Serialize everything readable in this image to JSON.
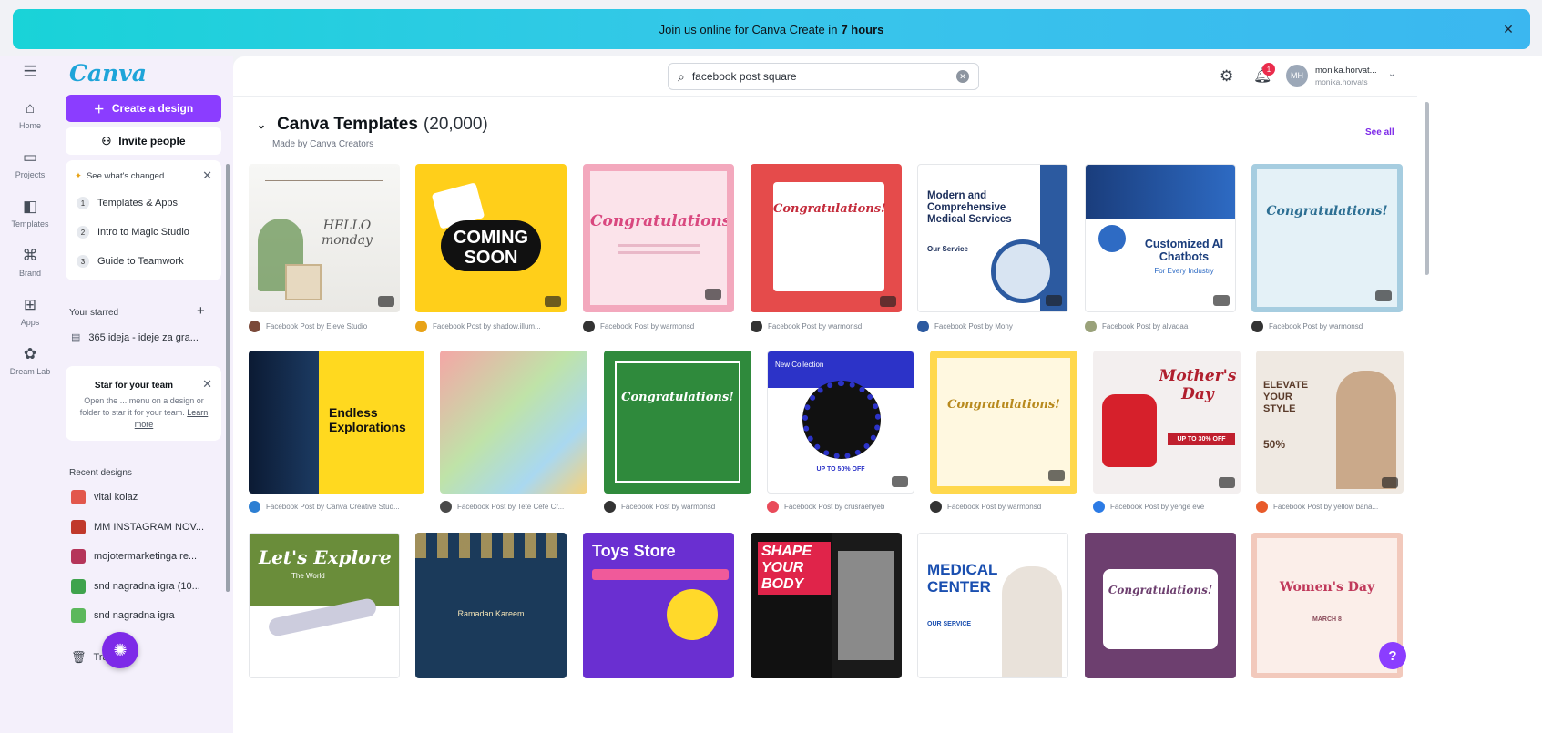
{
  "banner": {
    "text": "Join us online for Canva Create in",
    "bold": "7 hours"
  },
  "rail": [
    {
      "label": "Home",
      "icon": "home-icon"
    },
    {
      "label": "Projects",
      "icon": "folder-icon"
    },
    {
      "label": "Templates",
      "icon": "templates-icon"
    },
    {
      "label": "Brand",
      "icon": "brand-icon"
    },
    {
      "label": "Apps",
      "icon": "apps-icon"
    },
    {
      "label": "Dream Lab",
      "icon": "dream-lab-icon"
    }
  ],
  "panel": {
    "logo": "Canva",
    "create_label": "Create a design",
    "invite_label": "Invite people",
    "whats_new": {
      "title": "See what's changed",
      "items": [
        "Templates & Apps",
        "Intro to Magic Studio",
        "Guide to Teamwork"
      ],
      "nums": [
        "1",
        "2",
        "3"
      ]
    },
    "starred_title": "Your starred",
    "starred_item": "365 ideja - ideje za gra...",
    "star_team": {
      "title": "Star for your team",
      "desc": "Open the ... menu on a design or folder to star it for your team.",
      "link": "Learn more"
    },
    "recent_title": "Recent designs",
    "recent": [
      {
        "name": "vital kolaz",
        "color": "#e2574c"
      },
      {
        "name": "MM INSTAGRAM NOV...",
        "color": "#c0392b"
      },
      {
        "name": "mojotermarketinga re...",
        "color": "#b5355a"
      },
      {
        "name": "snd nagradna igra (10...",
        "color": "#3fa34d"
      },
      {
        "name": "snd nagradna igra",
        "color": "#5cb85c"
      }
    ],
    "trash_label": "Trash"
  },
  "topbar": {
    "search_value": "facebook post square",
    "user_name": "monika.horvat...",
    "user_sub": "monika.horvats",
    "avatar_initials": "MH",
    "notif_count": "1"
  },
  "section": {
    "title": "Canva Templates",
    "count": "(20,000)",
    "subtitle": "Made by Canva Creators",
    "see_all": "See all"
  },
  "templates": [
    [
      {
        "caption": "Facebook Post by Eleve Studio",
        "title": "HELLO monday",
        "av": "#7b4a3a"
      },
      {
        "caption": "Facebook Post by shadow.illum...",
        "title": "COMING SOON",
        "av": "#e8a317"
      },
      {
        "caption": "Facebook Post by warmonsd",
        "title": "Congratulations!",
        "av": "#333333"
      },
      {
        "caption": "Facebook Post by warmonsd",
        "title": "Congratulations!",
        "av": "#333333"
      },
      {
        "caption": "Facebook Post by Mony",
        "title": "Modern and Comprehensive Medical Services",
        "sub": "Our Service",
        "av": "#2c5aa0"
      },
      {
        "caption": "Facebook Post by alvadaa",
        "title": "Customized AI Chatbots",
        "sub": "For Every Industry",
        "av": "#9aa27a"
      },
      {
        "caption": "Facebook Post by warmonsd",
        "title": "Congratulations!",
        "av": "#333333"
      }
    ],
    [
      {
        "caption": "Facebook Post by Canva Creative Stud...",
        "title": "Endless Explorations",
        "av": "#2d7fd3"
      },
      {
        "caption": "Facebook Post by Tete Cefe Cr...",
        "title": "",
        "av": "#4a4a4a"
      },
      {
        "caption": "Facebook Post by warmonsd",
        "title": "Congratulations!",
        "av": "#333333"
      },
      {
        "caption": "Facebook Post by crusraehyeb",
        "title": "New Collection",
        "sub": "UP TO 50% OFF",
        "av": "#e94b5a"
      },
      {
        "caption": "Facebook Post by warmonsd",
        "title": "Congratulations!",
        "av": "#333333"
      },
      {
        "caption": "Facebook Post by yenge eve",
        "title": "Mother's Day",
        "sub": "UP TO 30% OFF",
        "av": "#2c7be5"
      },
      {
        "caption": "Facebook Post by yellow bana...",
        "title": "ELEVATE YOUR STYLE",
        "sub": "50%",
        "av": "#e85a2a"
      }
    ],
    [
      {
        "title": "Let's Explore",
        "sub": "The World"
      },
      {
        "title": "Ramadan Kareem"
      },
      {
        "title": "Toys Store"
      },
      {
        "title": "SHAPE YOUR BODY"
      },
      {
        "title": "MEDICAL CENTER",
        "sub": "OUR SERVICE"
      },
      {
        "title": "Congratulations!"
      },
      {
        "title": "Women's Day",
        "sub": "MARCH 8"
      }
    ]
  ],
  "help_label": "?"
}
